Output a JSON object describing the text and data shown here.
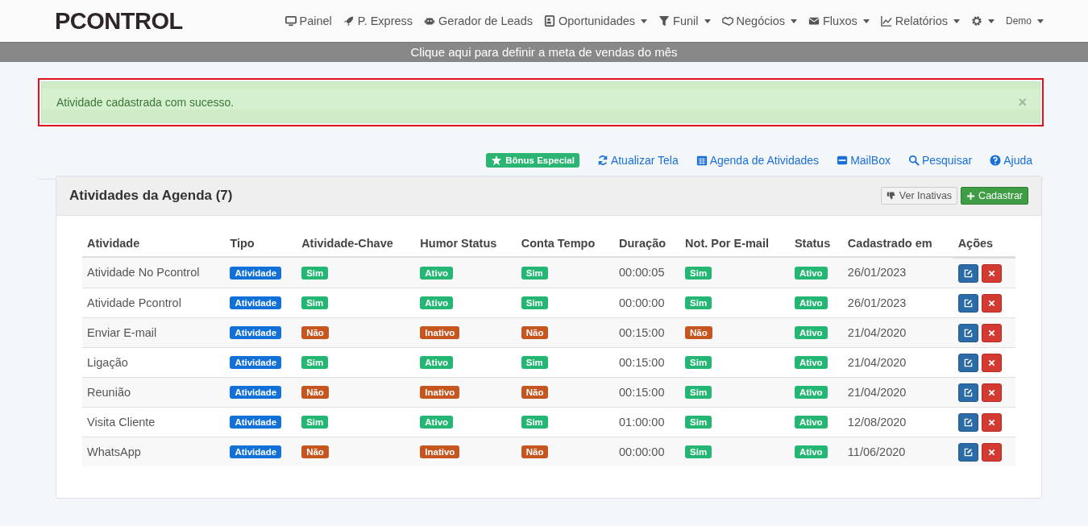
{
  "brand": {
    "logo": "PCONTROL"
  },
  "nav": [
    {
      "label": "Painel",
      "dropdown": false
    },
    {
      "label": "P. Express",
      "dropdown": false
    },
    {
      "label": "Gerador de Leads",
      "dropdown": false
    },
    {
      "label": "Oportunidades",
      "dropdown": true
    },
    {
      "label": "Funil",
      "dropdown": true
    },
    {
      "label": "Negócios",
      "dropdown": true
    },
    {
      "label": "Fluxos",
      "dropdown": true
    },
    {
      "label": "Relatórios",
      "dropdown": true
    },
    {
      "dropdown": true
    },
    {
      "label": "Demo",
      "dropdown": true
    }
  ],
  "goal_banner": "Clique aqui para definir a meta de vendas do mês",
  "alert": {
    "message": "Atividade cadastrada com sucesso.",
    "close": "×",
    "highlighted": true
  },
  "toolbar": [
    {
      "label": "Bônus Especial",
      "kind": "badge"
    },
    {
      "label": "Atualizar Tela",
      "kind": "link"
    },
    {
      "label": "Agenda de Atividades",
      "kind": "link"
    },
    {
      "label": "MailBox",
      "kind": "link"
    },
    {
      "label": "Pesquisar",
      "kind": "link"
    },
    {
      "label": "Ajuda",
      "kind": "link"
    }
  ],
  "panel": {
    "title": "Atividades da Agenda (7)",
    "buttons": [
      {
        "label": "Ver Inativas",
        "kind": "default"
      },
      {
        "label": "Cadastrar",
        "kind": "success"
      }
    ]
  },
  "table": {
    "columns": [
      "Atividade",
      "Tipo",
      "Atividade-Chave",
      "Humor Status",
      "Conta Tempo",
      "Duração",
      "Not. Por E-mail",
      "Status",
      "Cadastrado em",
      "Ações"
    ],
    "rows": [
      {
        "name": "Atividade No Pcontrol",
        "type": "Atividade",
        "key": {
          "text": "Sim",
          "on": true
        },
        "humor": {
          "text": "Ativo",
          "on": true
        },
        "timer": {
          "text": "Sim",
          "on": true
        },
        "duration": "00:00:05",
        "email": {
          "text": "Sim",
          "on": true
        },
        "status": {
          "text": "Ativo",
          "on": true
        },
        "created": "26/01/2023"
      },
      {
        "name": "Atividade Pcontrol",
        "type": "Atividade",
        "key": {
          "text": "Sim",
          "on": true
        },
        "humor": {
          "text": "Ativo",
          "on": true
        },
        "timer": {
          "text": "Sim",
          "on": true
        },
        "duration": "00:00:00",
        "email": {
          "text": "Sim",
          "on": true
        },
        "status": {
          "text": "Ativo",
          "on": true
        },
        "created": "26/01/2023"
      },
      {
        "name": "Enviar E-mail",
        "type": "Atividade",
        "key": {
          "text": "Não",
          "on": false
        },
        "humor": {
          "text": "Inativo",
          "on": false
        },
        "timer": {
          "text": "Não",
          "on": false
        },
        "duration": "00:15:00",
        "email": {
          "text": "Não",
          "on": false
        },
        "status": {
          "text": "Ativo",
          "on": true
        },
        "created": "21/04/2020"
      },
      {
        "name": "Ligação",
        "type": "Atividade",
        "key": {
          "text": "Sim",
          "on": true
        },
        "humor": {
          "text": "Ativo",
          "on": true
        },
        "timer": {
          "text": "Sim",
          "on": true
        },
        "duration": "00:15:00",
        "email": {
          "text": "Sim",
          "on": true
        },
        "status": {
          "text": "Ativo",
          "on": true
        },
        "created": "21/04/2020"
      },
      {
        "name": "Reunião",
        "type": "Atividade",
        "key": {
          "text": "Não",
          "on": false
        },
        "humor": {
          "text": "Inativo",
          "on": false
        },
        "timer": {
          "text": "Não",
          "on": false
        },
        "duration": "00:15:00",
        "email": {
          "text": "Sim",
          "on": true
        },
        "status": {
          "text": "Ativo",
          "on": true
        },
        "created": "21/04/2020"
      },
      {
        "name": "Visita Cliente",
        "type": "Atividade",
        "key": {
          "text": "Sim",
          "on": true
        },
        "humor": {
          "text": "Ativo",
          "on": true
        },
        "timer": {
          "text": "Sim",
          "on": true
        },
        "duration": "01:00:00",
        "email": {
          "text": "Sim",
          "on": true
        },
        "status": {
          "text": "Ativo",
          "on": true
        },
        "created": "12/08/2020"
      },
      {
        "name": "WhatsApp",
        "type": "Atividade",
        "key": {
          "text": "Não",
          "on": false
        },
        "humor": {
          "text": "Inativo",
          "on": false
        },
        "timer": {
          "text": "Não",
          "on": false
        },
        "duration": "00:00:00",
        "email": {
          "text": "Sim",
          "on": true
        },
        "status": {
          "text": "Ativo",
          "on": true
        },
        "created": "11/06/2020"
      }
    ]
  }
}
